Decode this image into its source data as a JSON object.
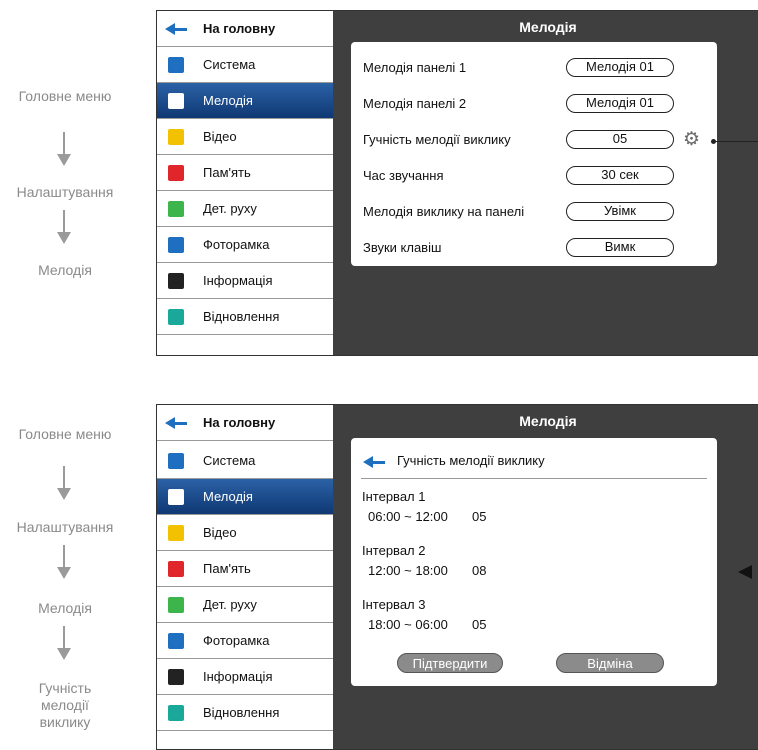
{
  "flow_top": [
    "Головне меню",
    "Налаштування",
    "Мелодія"
  ],
  "flow_bottom": [
    "Головне меню",
    "Налаштування",
    "Мелодія",
    "Гучність мелодії виклику"
  ],
  "menu": {
    "home": "На головну",
    "items": [
      {
        "label": "Система",
        "icon": "gear-icon",
        "color": "#1f6fc0"
      },
      {
        "label": "Мелодія",
        "icon": "phone-icon",
        "color": "#1f4fa0"
      },
      {
        "label": "Відео",
        "icon": "play-icon",
        "color": "#f2c200"
      },
      {
        "label": "Пам'ять",
        "icon": "memory-icon",
        "color": "#e0262b"
      },
      {
        "label": "Дет. руху",
        "icon": "motion-icon",
        "color": "#3cb54a"
      },
      {
        "label": "Фоторамка",
        "icon": "photo-icon",
        "color": "#1f6fc0"
      },
      {
        "label": "Інформація",
        "icon": "info-icon",
        "color": "#222222"
      },
      {
        "label": "Відновлення",
        "icon": "restore-icon",
        "color": "#19a89a"
      }
    ]
  },
  "screen1": {
    "title": "Мелодія",
    "rows": [
      {
        "label": "Мелодія панелі 1",
        "value": "Мелодія 01"
      },
      {
        "label": "Мелодія панелі 2",
        "value": "Мелодія 01"
      },
      {
        "label": "Гучність мелодії виклику",
        "value": "05"
      },
      {
        "label": "Час звучання",
        "value": "30 сек"
      },
      {
        "label": "Мелодія виклику на панелі",
        "value": "Увімк"
      },
      {
        "label": "Звуки клавіш",
        "value": "Вимк"
      }
    ]
  },
  "screen2": {
    "title": "Мелодія",
    "header": "Гучність мелодії виклику",
    "intervals": [
      {
        "name": "Інтервал 1",
        "time": "06:00 ~ 12:00",
        "value": "05"
      },
      {
        "name": "Інтервал 2",
        "time": "12:00 ~ 18:00",
        "value": "08"
      },
      {
        "name": "Інтервал 3",
        "time": "18:00 ~ 06:00",
        "value": "05"
      }
    ],
    "confirm": "Підтвердити",
    "cancel": "Відміна"
  }
}
